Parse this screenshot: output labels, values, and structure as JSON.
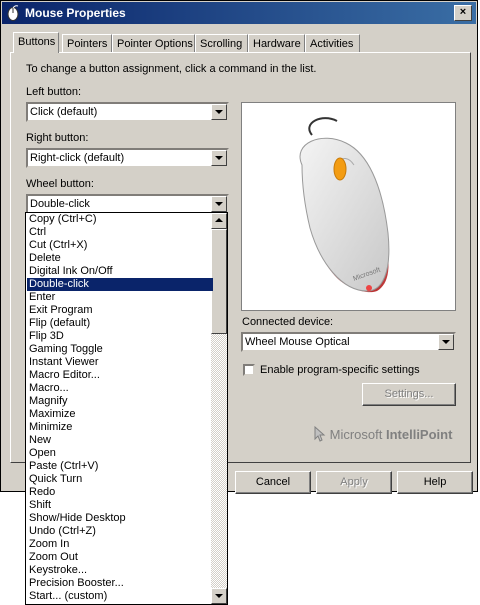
{
  "window": {
    "title": "Mouse Properties",
    "close_label": "×"
  },
  "tabs": [
    {
      "label": "Buttons",
      "active": true
    },
    {
      "label": "Pointers"
    },
    {
      "label": "Pointer Options"
    },
    {
      "label": "Scrolling"
    },
    {
      "label": "Hardware"
    },
    {
      "label": "Activities"
    }
  ],
  "instructions": "To change a button assignment, click a command in the list.",
  "left_button": {
    "label": "Left button:",
    "value": "Click (default)"
  },
  "right_button": {
    "label": "Right button:",
    "value": "Right-click (default)"
  },
  "wheel_button": {
    "label": "Wheel button:",
    "value": "Double-click"
  },
  "connected_device": {
    "label": "Connected device:",
    "value": "Wheel Mouse Optical"
  },
  "program_settings": {
    "label": "Enable program-specific settings",
    "checked": false
  },
  "settings_button": "Settings...",
  "brand": {
    "microsoft": "Microsoft",
    "product": "IntelliPoint"
  },
  "mouse_logo": "Microsoft",
  "footer": {
    "cancel": "Cancel",
    "apply": "Apply",
    "help": "Help"
  },
  "command_list": {
    "selected_index": 5,
    "items": [
      "Copy (Ctrl+C)",
      "Ctrl",
      "Cut (Ctrl+X)",
      "Delete",
      "Digital Ink On/Off",
      "Double-click",
      "Enter",
      "Exit Program",
      "Flip (default)",
      "Flip 3D",
      "Gaming Toggle",
      "Instant Viewer",
      "Macro Editor...",
      "Macro...",
      "Magnify",
      "Maximize",
      "Minimize",
      "New",
      "Open",
      "Paste (Ctrl+V)",
      "Quick Turn",
      "Redo",
      "Shift",
      "Show/Hide Desktop",
      "Undo (Ctrl+Z)",
      "Zoom In",
      "Zoom Out",
      "Keystroke...",
      "Precision Booster...",
      "Start... (custom)"
    ]
  }
}
